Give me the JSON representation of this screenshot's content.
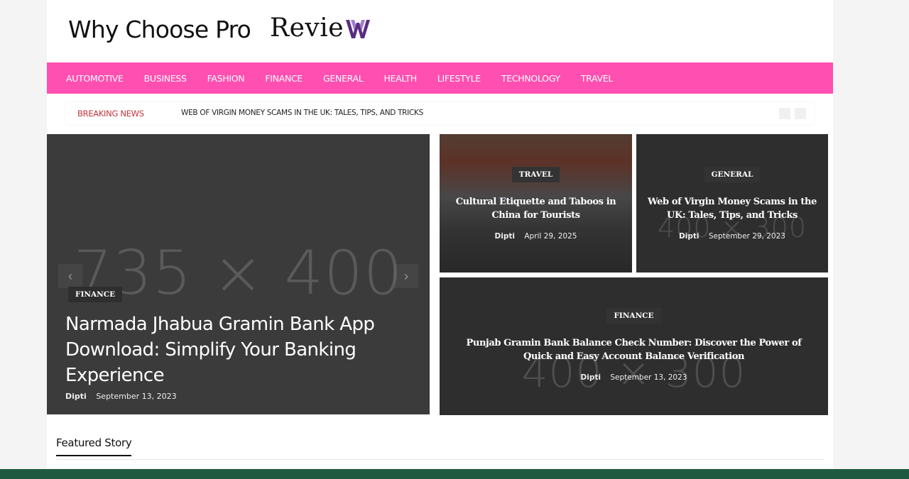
{
  "header": {
    "site_title": "Why Choose Pro",
    "logo_text": "Revie",
    "logo_color": "#5a2d82"
  },
  "nav": {
    "background": "#ff4fb0",
    "items": [
      {
        "label": "AUTOMOTIVE"
      },
      {
        "label": "BUSINESS"
      },
      {
        "label": "FASHION"
      },
      {
        "label": "FINANCE"
      },
      {
        "label": "GENERAL"
      },
      {
        "label": "HEALTH"
      },
      {
        "label": "LIFESTYLE"
      },
      {
        "label": "TECHNOLOGY"
      },
      {
        "label": "TRAVEL"
      }
    ]
  },
  "breaking": {
    "label": "BREAKING NEWS",
    "headline": "WEB OF VIRGIN MONEY SCAMS IN THE UK: TALES, TIPS, AND TRICKS"
  },
  "hero": {
    "placeholder": "735 × 400",
    "category": "FINANCE",
    "title": "Narmada Jhabua Gramin Bank App Download: Simplify Your Banking Experience",
    "author": "Dipti",
    "date": "September 13, 2023",
    "prev_icon": "chevron-left-icon",
    "next_icon": "chevron-right-icon"
  },
  "cards": [
    {
      "category": "TRAVEL",
      "title": "Cultural Etiquette and Taboos in China for Tourists",
      "author": "Dipti",
      "date": "April 29, 2025"
    },
    {
      "placeholder": "400 × 300",
      "category": "GENERAL",
      "title": "Web of Virgin Money Scams in the UK: Tales, Tips, and Tricks",
      "author": "Dipti",
      "date": "September 29, 2023"
    },
    {
      "placeholder": "400 × 300",
      "category": "FINANCE",
      "title": "Punjab Gramin Bank Balance Check Number: Discover the Power of Quick and Easy Account Balance Verification",
      "author": "Dipti",
      "date": "September 13, 2023"
    }
  ],
  "featured": {
    "title": "Featured Story"
  }
}
